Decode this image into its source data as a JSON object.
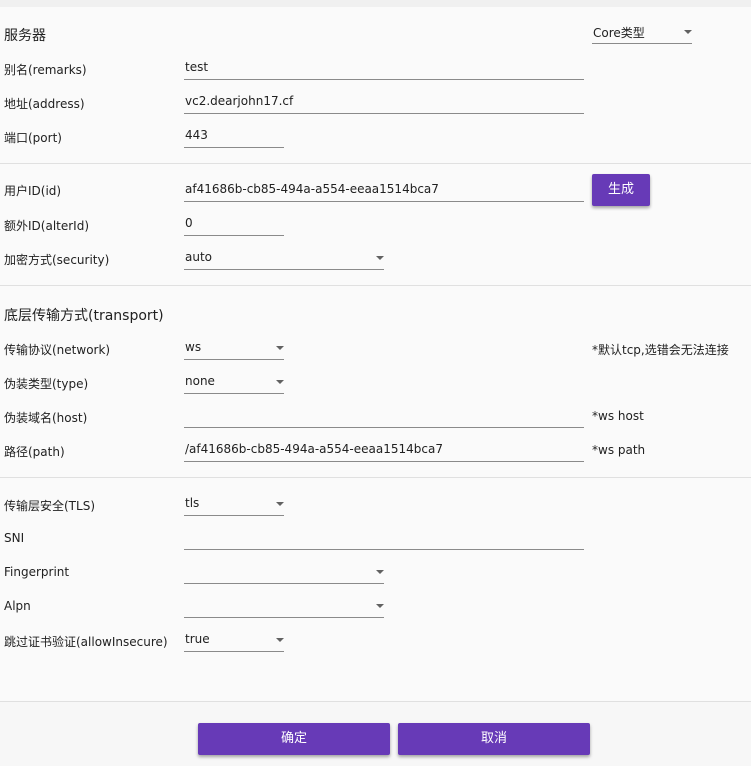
{
  "server": {
    "section_title": "服务器",
    "core_type_placeholder": "Core类型",
    "remarks_label": "别名(remarks)",
    "remarks_value": "test",
    "address_label": "地址(address)",
    "address_value": "vc2.dearjohn17.cf",
    "port_label": "端口(port)",
    "port_value": "443"
  },
  "user": {
    "id_label": "用户ID(id)",
    "id_value": "af41686b-cb85-494a-a554-eeaa1514bca7",
    "generate_button": "生成",
    "alter_id_label": "额外ID(alterId)",
    "alter_id_value": "0",
    "security_label": "加密方式(security)",
    "security_value": "auto"
  },
  "transport": {
    "section_title": "底层传输方式(transport)",
    "network_label": "传输协议(network)",
    "network_value": "ws",
    "network_hint": "*默认tcp,选错会无法连接",
    "type_label": "伪装类型(type)",
    "type_value": "none",
    "host_label": "伪装域名(host)",
    "host_value": "",
    "host_hint": "*ws host",
    "path_label": "路径(path)",
    "path_value": "/af41686b-cb85-494a-a554-eeaa1514bca7",
    "path_hint": "*ws path"
  },
  "tls": {
    "tls_label": "传输层安全(TLS)",
    "tls_value": "tls",
    "sni_label": "SNI",
    "sni_value": "",
    "fingerprint_label": "Fingerprint",
    "fingerprint_value": "",
    "alpn_label": "Alpn",
    "alpn_value": "",
    "allow_insecure_label": "跳过证书验证(allowInsecure)",
    "allow_insecure_value": "true"
  },
  "footer": {
    "ok_button": "确定",
    "cancel_button": "取消"
  },
  "colors": {
    "accent": "#673ab7",
    "background": "#fafafa",
    "divider": "#e0e0e0"
  }
}
